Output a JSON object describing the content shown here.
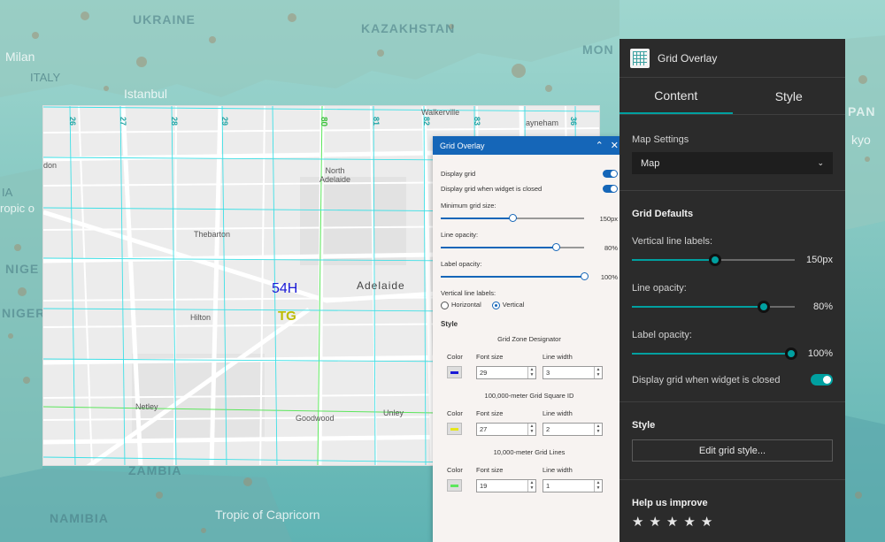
{
  "world_map": {
    "labels": {
      "ukraine": "UKRAINE",
      "kazakhstan": "KAZAKHSTAN",
      "milan": "Milan",
      "italy": "ITALY",
      "istanbul": "Istanbul",
      "mongolia": "MON",
      "japan": "PAN",
      "tokyo": "kyo",
      "ia": "IA",
      "tropic_left": "ropic o",
      "nigeria": "NIGE",
      "nigeria2": "NIGERIA",
      "zambia": "ZAMBIA",
      "namibia": "NAMIBIA",
      "tropic_capricorn": "Tropic of Capricorn"
    }
  },
  "city_map": {
    "labels": {
      "walkerville": "Walkerville",
      "payneham": "ayneham",
      "don": "don",
      "north_adelaide": "North\nAdelaide",
      "thebarton": "Thebarton",
      "adelaide": "Adelaide",
      "hilton": "Hilton",
      "netley": "Netley",
      "goodwood": "Goodwood",
      "unley": "Unley"
    },
    "grid_zone_designator": "54H",
    "grid_square_id": "TG",
    "tick_labels": [
      "26",
      "27",
      "28",
      "29",
      "80",
      "81",
      "82",
      "83",
      "36"
    ]
  },
  "overlay_panel": {
    "title": "Grid Overlay",
    "display_grid_label": "Display grid",
    "display_grid_closed_label": "Display grid when widget is closed",
    "min_grid_size_label": "Minimum grid size:",
    "min_grid_size_value": "150px",
    "min_grid_size_fraction": 0.5,
    "line_opacity_label": "Line opacity:",
    "line_opacity_value": "80%",
    "line_opacity_fraction": 0.8,
    "label_opacity_label": "Label opacity:",
    "label_opacity_value": "100%",
    "label_opacity_fraction": 1.0,
    "vertical_labels_label": "Vertical line labels:",
    "radio_horizontal": "Horizontal",
    "radio_vertical": "Vertical",
    "style_title": "Style",
    "color_head": "Color",
    "font_size_head": "Font size",
    "line_width_head": "Line width",
    "cards": [
      {
        "title": "Grid Zone Designator",
        "color": "#1a1ad6",
        "font_size": "29",
        "line_width": "3"
      },
      {
        "title": "100,000-meter Grid Square ID",
        "color": "#e6e61a",
        "font_size": "27",
        "line_width": "2"
      },
      {
        "title": "10,000-meter Grid Lines",
        "color": "#5ce65c",
        "font_size": "19",
        "line_width": "1"
      }
    ]
  },
  "side_panel": {
    "title": "Grid Overlay",
    "tabs": [
      "Content",
      "Style"
    ],
    "map_settings_label": "Map Settings",
    "map_select_value": "Map",
    "grid_defaults_title": "Grid Defaults",
    "vertical_labels_label": "Vertical line labels:",
    "vertical_labels_value": "150px",
    "vertical_labels_fraction": 0.51,
    "line_opacity_label": "Line opacity:",
    "line_opacity_value": "80%",
    "line_opacity_fraction": 0.81,
    "label_opacity_label": "Label opacity:",
    "label_opacity_value": "100%",
    "label_opacity_fraction": 0.98,
    "display_closed_label": "Display grid when widget is closed",
    "style_title": "Style",
    "edit_button": "Edit grid style...",
    "help_title": "Help us improve",
    "rating_stars": 5
  },
  "colors": {
    "accent": "#00a0a0",
    "overlay_blue": "#1566b8",
    "grid_cyan": "#3fe0e6",
    "grid_green": "#5ce65c"
  }
}
